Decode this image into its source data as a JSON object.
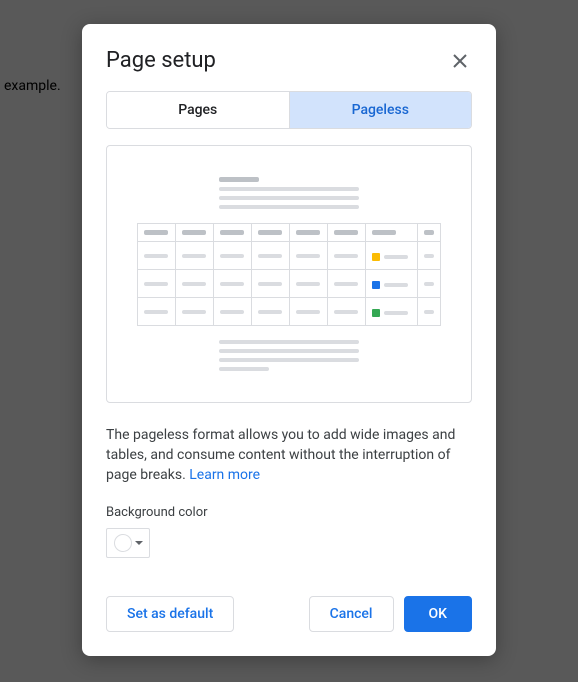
{
  "background": {
    "text": "example."
  },
  "dialog": {
    "title": "Page setup",
    "tabs": {
      "pages": "Pages",
      "pageless": "Pageless"
    },
    "description": "The pageless format allows you to add wide images and tables, and consume content without the interruption of page breaks. ",
    "learn_more": "Learn more",
    "bgcolor_label": "Background color",
    "buttons": {
      "set_default": "Set as default",
      "cancel": "Cancel",
      "ok": "OK"
    }
  }
}
